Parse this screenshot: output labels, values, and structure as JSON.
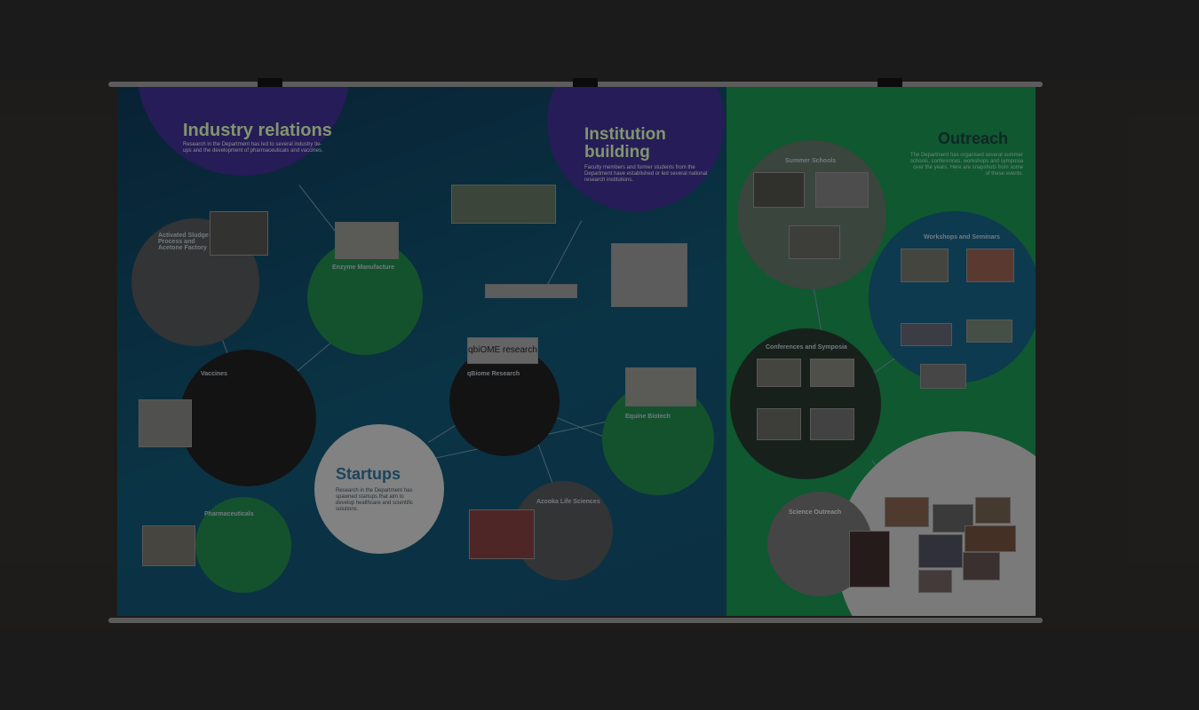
{
  "poster": {
    "industry": {
      "title": "Industry relations",
      "text": "Research in the Department has led to several industry tie-ups and the development of pharmaceuticals and vaccines."
    },
    "institution": {
      "title": "Institution building",
      "text": "Faculty members and former students from the Department have established or led several national research institutions."
    },
    "outreach": {
      "title": "Outreach",
      "text": "The Department has organised several summer schools, conferences, workshops and symposia over the years. Here are snapshots from some of these events."
    },
    "startups": {
      "title": "Startups",
      "text": "Research in the Department has spawned startups that aim to develop healthcare and scientific solutions."
    },
    "nodes": {
      "sludge": {
        "title": "Activated Sludge Process and Acetone Factory"
      },
      "enzyme": {
        "title": "Enzyme Manufacture"
      },
      "vaccines": {
        "title": "Vaccines"
      },
      "pharma": {
        "title": "Pharmaceuticals"
      },
      "qbiome": {
        "title": "qBiome Research",
        "logo": "qbiOME research"
      },
      "equine": {
        "title": "Equine Biotech"
      },
      "azooka": {
        "title": "Azooka Life Sciences"
      },
      "summer": {
        "title": "Summer Schools"
      },
      "workshops": {
        "title": "Workshops and Seminars"
      },
      "conferences": {
        "title": "Conferences and Symposia"
      },
      "science": {
        "title": "Science Outreach"
      }
    }
  }
}
